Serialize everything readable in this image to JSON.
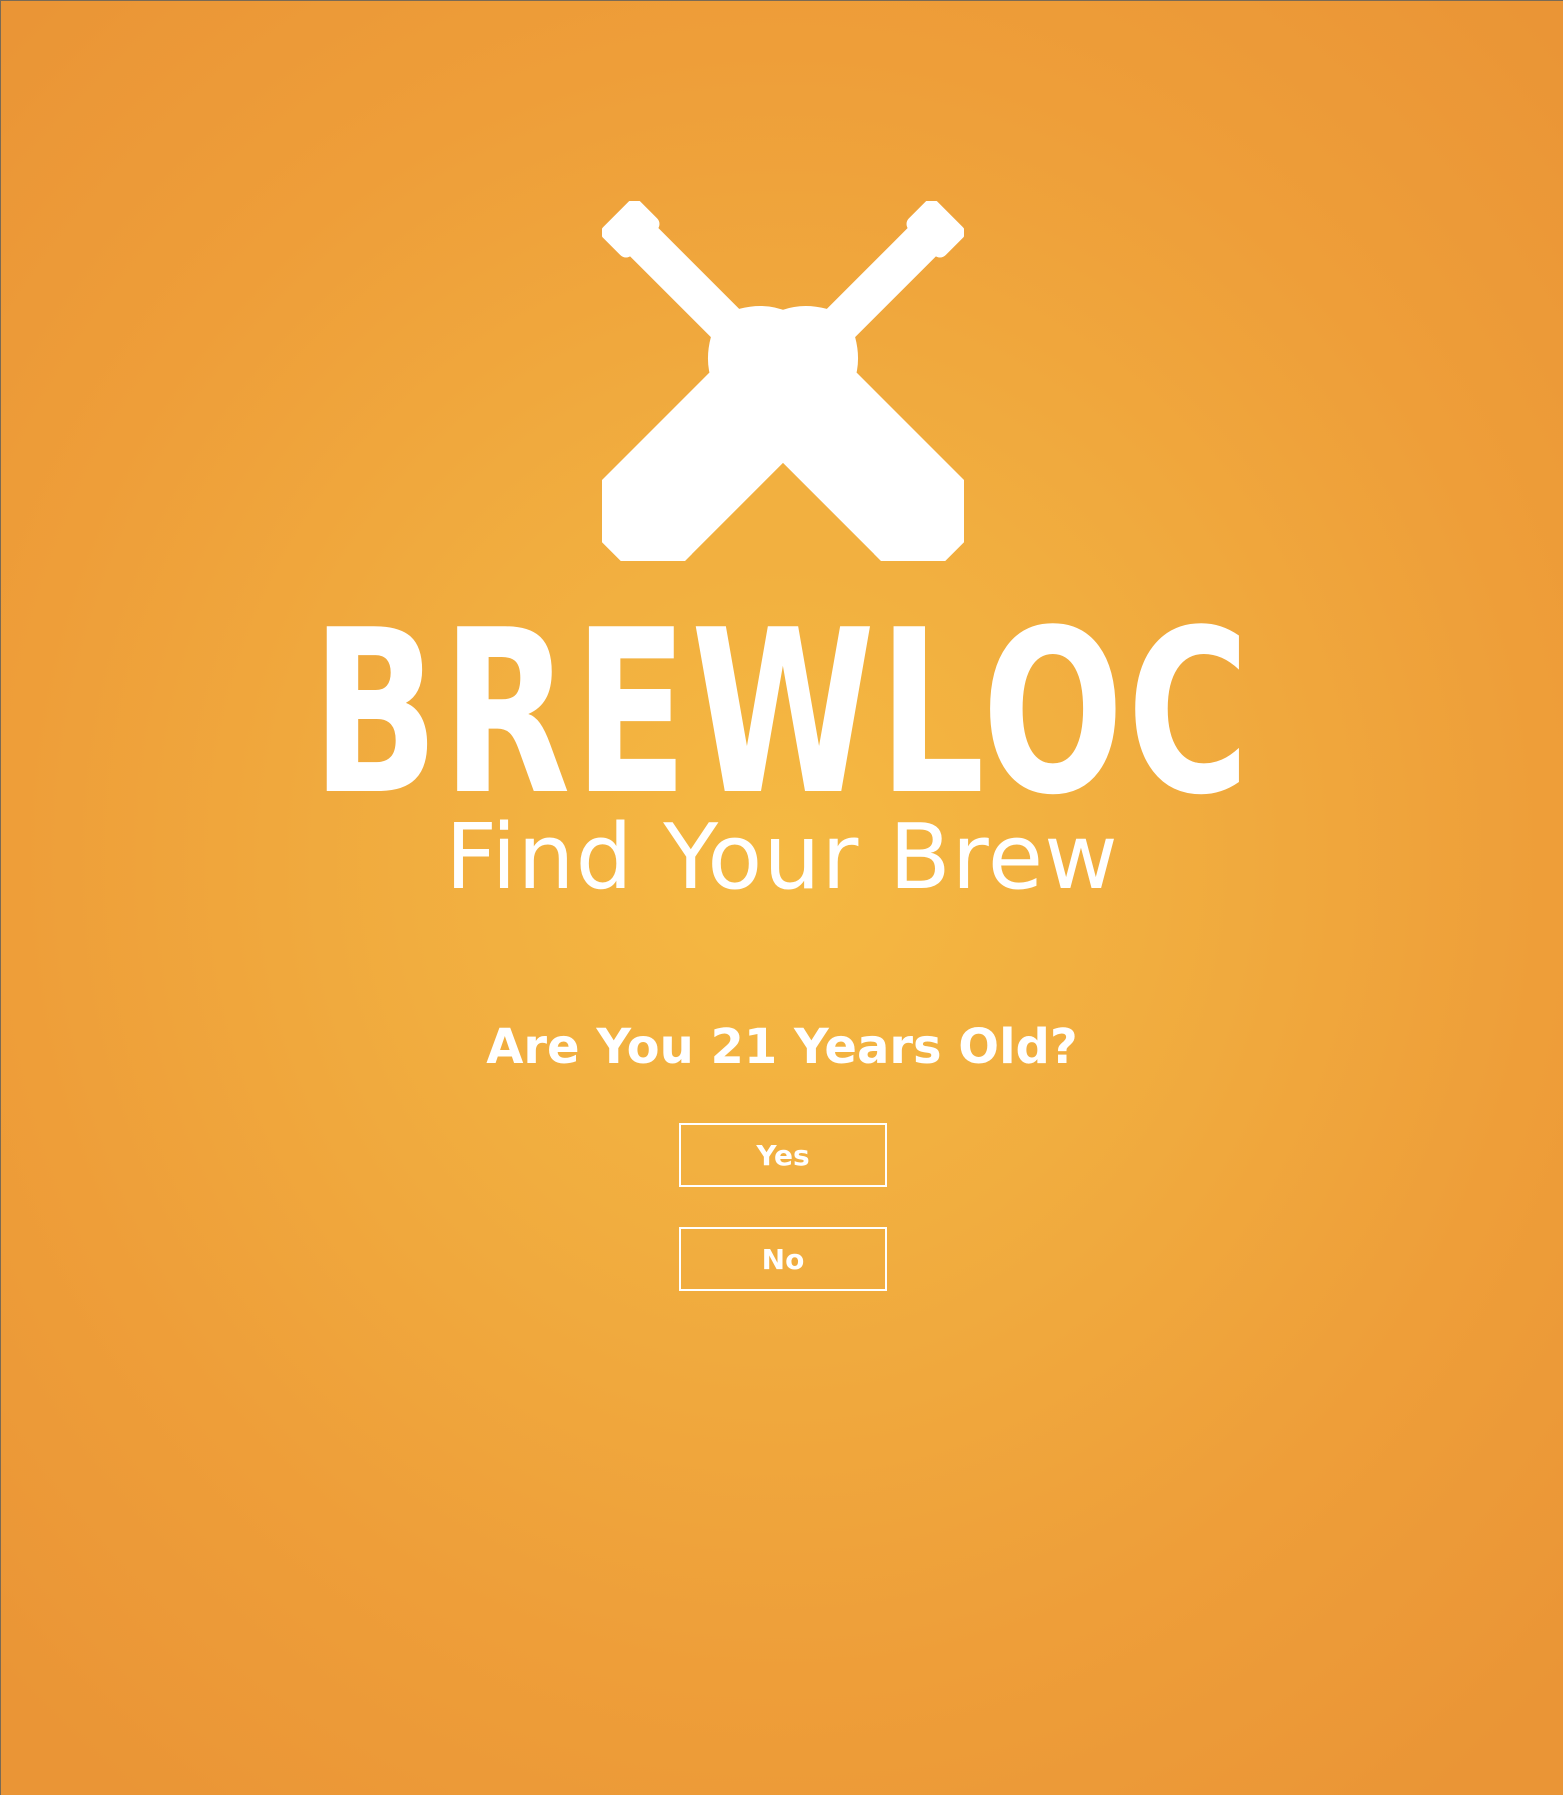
{
  "brand": {
    "logo_icon": "crossed-bottles-icon",
    "name": "BREWLOC",
    "tagline": "Find Your Brew"
  },
  "age_gate": {
    "question": "Are You 21 Years Old?",
    "yes_label": "Yes",
    "no_label": "No"
  },
  "colors": {
    "background_center": "#f5b942",
    "background_edge": "#ea9536",
    "foreground": "#ffffff"
  }
}
